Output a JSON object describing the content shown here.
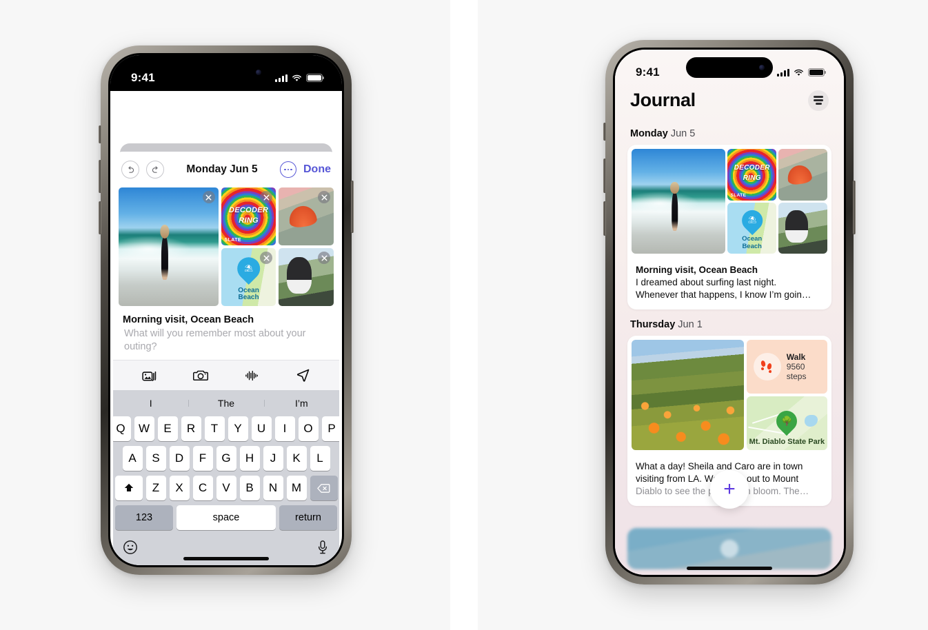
{
  "left_phone": {
    "status_bar": {
      "time": "9:41",
      "cellular": "cellular-bars-icon",
      "wifi": "wifi-icon",
      "battery": "battery-icon"
    },
    "sheet": {
      "undo_icon": "undo-icon",
      "redo_icon": "redo-icon",
      "title": "Monday Jun 5",
      "more_icon": "ellipsis-circle-icon",
      "done_label": "Done",
      "accent": "#5656d6"
    },
    "media": [
      {
        "name": "beach-surfer-photo",
        "alt": "Surfer walking on beach",
        "remove": "remove-icon"
      },
      {
        "name": "decoder-ring-podcast",
        "alt": "Decoder Ring podcast artwork",
        "line1": "DECODER",
        "line2": "RING",
        "brand": "SLATE",
        "remove": "remove-icon"
      },
      {
        "name": "seashell-photo",
        "alt": "Orange seashell on sand",
        "remove": "remove-icon"
      },
      {
        "name": "ocean-beach-map",
        "alt": "Map location",
        "label_line1": "Ocean",
        "label_line2": "Beach",
        "pin_glyph": "⛱",
        "remove": "remove-icon"
      },
      {
        "name": "dog-in-car-photo",
        "alt": "Dog looking out car window",
        "remove": "remove-icon"
      }
    ],
    "entry": {
      "title": "Morning visit, Ocean Beach",
      "placeholder": "What will you remember most about your outing?"
    },
    "toolbar": [
      {
        "name": "photos-icon",
        "label": "Photos"
      },
      {
        "name": "camera-icon",
        "label": "Camera"
      },
      {
        "name": "audio-waveform-icon",
        "label": "Record audio"
      },
      {
        "name": "location-icon",
        "label": "Location"
      }
    ],
    "keyboard": {
      "predictions": [
        "I",
        "The",
        "I’m"
      ],
      "row1": [
        "Q",
        "W",
        "E",
        "R",
        "T",
        "Y",
        "U",
        "I",
        "O",
        "P"
      ],
      "row2": [
        "A",
        "S",
        "D",
        "F",
        "G",
        "H",
        "J",
        "K",
        "L"
      ],
      "row3": [
        "Z",
        "X",
        "C",
        "V",
        "B",
        "N",
        "M"
      ],
      "shift_icon": "shift-icon",
      "backspace_icon": "backspace-icon",
      "numbers_label": "123",
      "space_label": "space",
      "return_label": "return",
      "emoji_icon": "emoji-icon",
      "dictation_icon": "microphone-icon"
    }
  },
  "right_phone": {
    "status_bar": {
      "time": "9:41",
      "cellular": "cellular-bars-icon",
      "wifi": "wifi-icon",
      "battery": "battery-icon"
    },
    "header": {
      "title": "Journal",
      "filter_icon": "filter-icon"
    },
    "entries": [
      {
        "day": "Monday",
        "date": "Jun 5",
        "media": [
          {
            "name": "beach-surfer-photo",
            "alt": "Surfer walking on beach"
          },
          {
            "name": "decoder-ring-podcast",
            "line1": "DECODER",
            "line2": "RING",
            "brand": "SLATE"
          },
          {
            "name": "seashell-photo",
            "alt": "Orange seashell on sand"
          },
          {
            "name": "ocean-beach-map",
            "label_line1": "Ocean",
            "label_line2": "Beach",
            "pin_glyph": "⛱"
          },
          {
            "name": "dog-in-car-photo",
            "alt": "Dog looking out car window"
          }
        ],
        "title": "Morning visit, Ocean Beach",
        "line2": "I dreamed about surfing last night.",
        "line3": "Whenever that happens, I know I’m goin…"
      },
      {
        "day": "Thursday",
        "date": "Jun 1",
        "media": [
          {
            "name": "poppy-hills-photo",
            "alt": "Orange poppies on green hills"
          },
          {
            "name": "walk-workout-card",
            "title": "Walk",
            "subtitle": "9560 steps",
            "icon": "footprints-icon",
            "color": "#fbdcc9"
          },
          {
            "name": "park-map-card",
            "label": "Mt. Diablo State Park",
            "icon": "tree-pin-icon",
            "color": "#d8ecc2"
          }
        ],
        "line1": "What a day! Sheila and Caro are in town",
        "line2": "visiting from LA. We drove out to Mount",
        "line3": "Diablo to see the poppies in bloom. The…"
      }
    ],
    "fab": {
      "icon": "plus-icon",
      "label": "New entry",
      "color": "#5e3ae0"
    },
    "partial_card": {
      "name": "partial-video-card",
      "play_icon": "play-icon"
    }
  }
}
